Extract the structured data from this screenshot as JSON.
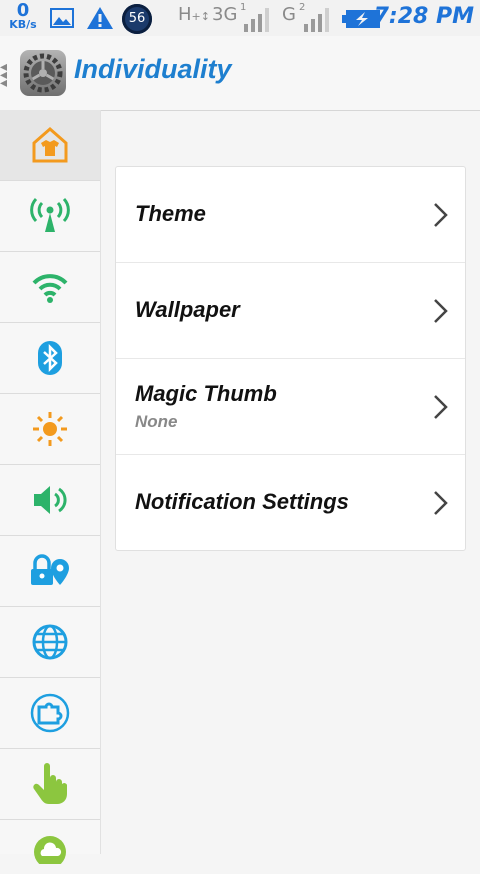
{
  "status_bar": {
    "speed_value": "0",
    "speed_unit": "KB/s",
    "badge_count": "56",
    "network1": "3G",
    "network2": "G",
    "network1_prefix": "H",
    "network2_index": "2",
    "network1_index": "1",
    "time": "7:28 PM",
    "icons": [
      "image-icon",
      "warning-icon",
      "battery-charging-icon"
    ]
  },
  "header": {
    "title": "Individuality",
    "back_icon": "back-arrows-icon",
    "logo_icon": "settings-gear-icon"
  },
  "sidebar": {
    "items": [
      {
        "name": "theme",
        "icon": "shirt-home-icon",
        "color": "#f39a1e",
        "active": true
      },
      {
        "name": "mobile-network",
        "icon": "antenna-icon",
        "color": "#2db36a"
      },
      {
        "name": "wifi",
        "icon": "wifi-icon",
        "color": "#2db36a"
      },
      {
        "name": "bluetooth",
        "icon": "bluetooth-icon",
        "color": "#1e9fe0"
      },
      {
        "name": "brightness",
        "icon": "sun-icon",
        "color": "#f39a1e"
      },
      {
        "name": "sound",
        "icon": "speaker-icon",
        "color": "#2db36a"
      },
      {
        "name": "location-security",
        "icon": "lock-location-icon",
        "color": "#1e9fe0"
      },
      {
        "name": "language",
        "icon": "globe-icon",
        "color": "#1e9fe0"
      },
      {
        "name": "apps",
        "icon": "puzzle-icon",
        "color": "#1e9fe0"
      },
      {
        "name": "gestures",
        "icon": "hand-icon",
        "color": "#8cc63f"
      },
      {
        "name": "cloud",
        "icon": "cloud-icon",
        "color": "#8cc63f"
      }
    ]
  },
  "menu": {
    "items": [
      {
        "title": "Theme",
        "subtitle": ""
      },
      {
        "title": "Wallpaper",
        "subtitle": ""
      },
      {
        "title": "Magic Thumb",
        "subtitle": "None"
      },
      {
        "title": "Notification Settings",
        "subtitle": ""
      }
    ]
  }
}
